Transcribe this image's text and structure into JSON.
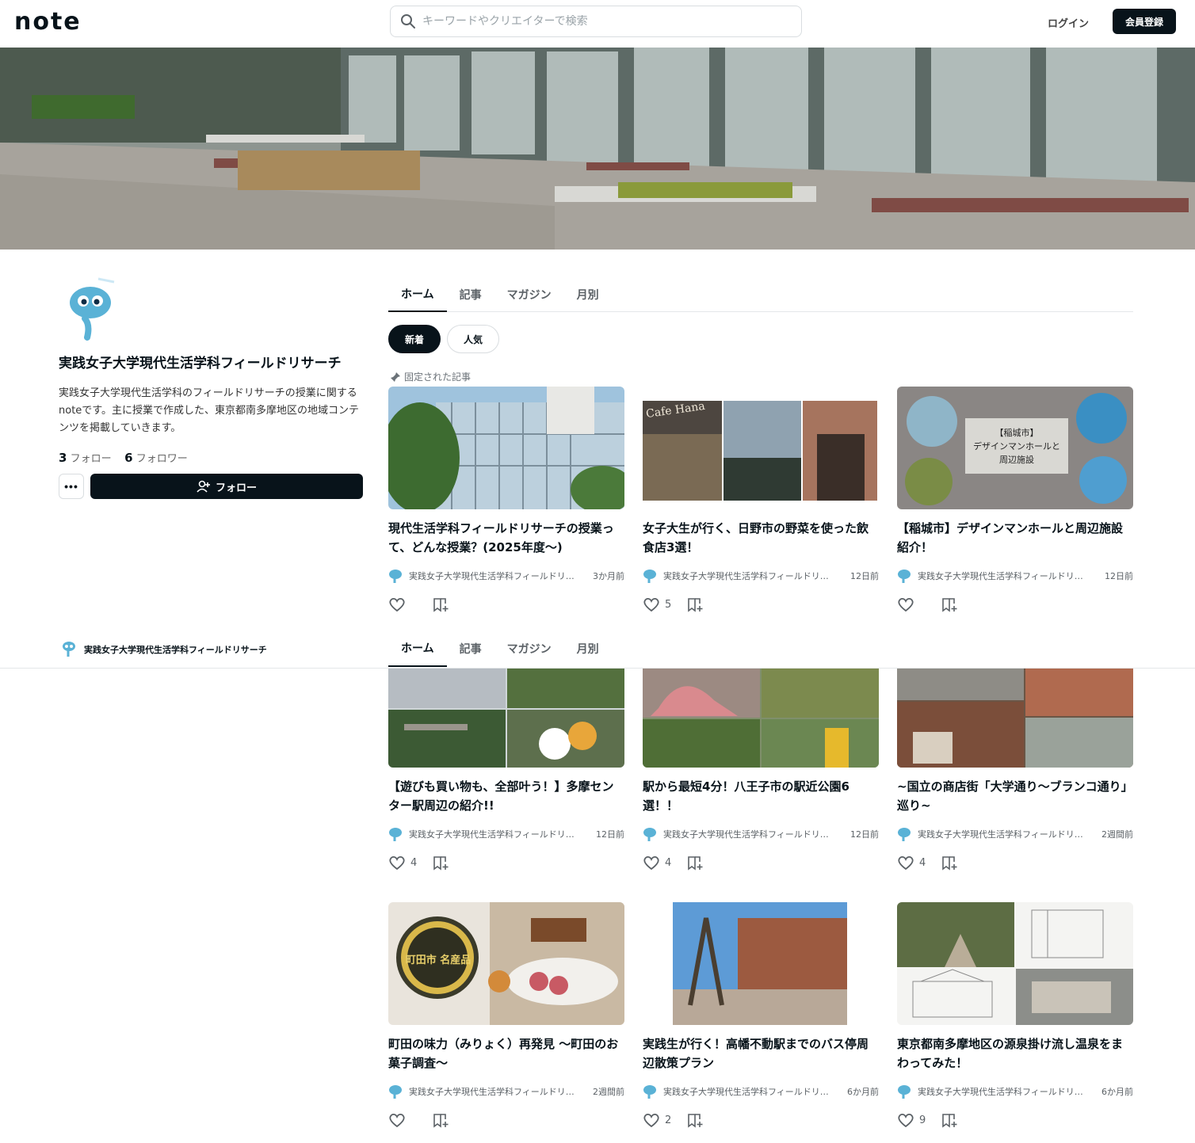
{
  "header": {
    "logo": "note",
    "search_placeholder": "キーワードやクリエイターで検索",
    "login_label": "ログイン",
    "signup_label": "会員登録"
  },
  "profile": {
    "name": "実践女子大学現代生活学科フィールドリサーチ",
    "description": "実践女子大学現代生活学科のフィールドリサーチの授業に関するnoteです。主に授業で作成した、東京都南多摩地区の地域コンテンツを掲載していきます。",
    "follow_count": "3",
    "follow_label": "フォロー",
    "follower_count": "6",
    "follower_label": "フォロワー",
    "more_label": "•••",
    "follow_button_label": "フォロー"
  },
  "tabs": [
    "ホーム",
    "記事",
    "マガジン",
    "月別"
  ],
  "chips": [
    "新着",
    "人気"
  ],
  "pinned_label": "固定された記事",
  "sticky": {
    "name": "実践女子大学現代生活学科フィールドリサーチ"
  },
  "articles": [
    {
      "title": "現代生活学科フィールドリサーチの授業って、どんな授業？(2025年度〜)",
      "author": "実践女子大学現代生活学科フィールドリサーチ",
      "time": "3か月前",
      "likes": ""
    },
    {
      "title": "女子大生が行く、日野市の野菜を使った飲食店3選！",
      "author": "実践女子大学現代生活学科フィールドリサーチ",
      "time": "12日前",
      "likes": "5",
      "cover_text": "Cafe Hana"
    },
    {
      "title": "【稲城市】デザインマンホールと周辺施設紹介！",
      "author": "実践女子大学現代生活学科フィールドリサーチ",
      "time": "12日前",
      "likes": "",
      "cover_text": "【稲城市】\nデザインマンホールと\n周辺施設"
    },
    {
      "title": "【遊びも買い物も、全部叶う！】多摩センター駅周辺の紹介!!",
      "author": "実践女子大学現代生活学科フィールドリサーチ",
      "time": "12日前",
      "likes": "4"
    },
    {
      "title": "駅から最短4分！八王子市の駅近公園6選！！",
      "author": "実践女子大学現代生活学科フィールドリサーチ",
      "time": "12日前",
      "likes": "4"
    },
    {
      "title": "~国立の商店街「大学通り～ブランコ通り」巡り~",
      "author": "実践女子大学現代生活学科フィールドリサーチ",
      "time": "2週間前",
      "likes": "4"
    },
    {
      "title": "町田の味力（みりょく）再発見 〜町田のお菓子調査〜",
      "author": "実践女子大学現代生活学科フィールドリサーチ",
      "time": "2週間前",
      "likes": "",
      "cover_text": "町田市 名産品"
    },
    {
      "title": "実践生が行く！高幡不動駅までのバス停周辺散策プラン",
      "author": "実践女子大学現代生活学科フィールドリサーチ",
      "time": "6か月前",
      "likes": "2"
    },
    {
      "title": "東京都南多摩地区の源泉掛け流し温泉をまわってみた！",
      "author": "実践女子大学現代生活学科フィールドリサーチ",
      "time": "6か月前",
      "likes": "9"
    }
  ]
}
